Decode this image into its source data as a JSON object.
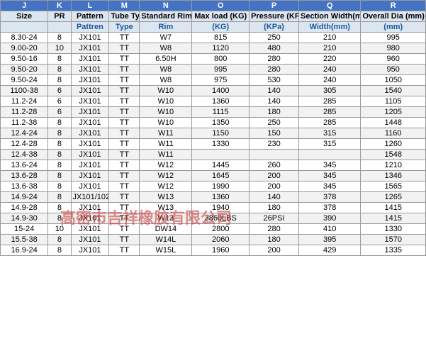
{
  "columns": {
    "headers_row1": [
      "J",
      "K",
      "L",
      "M",
      "N",
      "O",
      "P",
      "Q",
      "R"
    ],
    "headers_row2": [
      "Size",
      "PR",
      "Pattern",
      "Tube Type",
      "Standard Rim",
      "Max load (KG)",
      "Pressure (KPa)",
      "Section Width(mm)",
      "Overall Dia (mm)"
    ],
    "sub_headers": [
      "",
      "",
      "",
      "Type",
      "Rim",
      "(KG)",
      "(KPa)",
      "Width(mm)",
      "(mm)"
    ]
  },
  "rows": [
    [
      "8.30-24",
      "8",
      "JX101",
      "TT",
      "W7",
      "815",
      "250",
      "210",
      "995"
    ],
    [
      "9.00-20",
      "10",
      "JX101",
      "TT",
      "W8",
      "1120",
      "480",
      "210",
      "980"
    ],
    [
      "9.50-16",
      "8",
      "JX101",
      "TT",
      "6.50H",
      "800",
      "280",
      "220",
      "960"
    ],
    [
      "9.50-20",
      "8",
      "JX101",
      "TT",
      "W8",
      "995",
      "280",
      "240",
      "950"
    ],
    [
      "9.50-24",
      "8",
      "JX101",
      "TT",
      "W8",
      "975",
      "530",
      "240",
      "1050"
    ],
    [
      "1100-38",
      "6",
      "JX101",
      "TT",
      "W10",
      "1400",
      "140",
      "305",
      "1540"
    ],
    [
      "11.2-24",
      "6",
      "JX101",
      "TT",
      "W10",
      "1360",
      "140",
      "285",
      "1105"
    ],
    [
      "11.2-28",
      "6",
      "JX101",
      "TT",
      "W10",
      "1115",
      "180",
      "285",
      "1205"
    ],
    [
      "11.2-38",
      "8",
      "JX101",
      "TT",
      "W10",
      "1350",
      "250",
      "285",
      "1448"
    ],
    [
      "12.4-24",
      "8",
      "JX101",
      "TT",
      "W11",
      "1150",
      "150",
      "315",
      "1160"
    ],
    [
      "12.4-28",
      "8",
      "JX101",
      "TT",
      "W11",
      "1330",
      "230",
      "315",
      "1260"
    ],
    [
      "12.4-38",
      "8",
      "JX101",
      "TT",
      "W11",
      "",
      "",
      "",
      "1548"
    ],
    [
      "13.6-24",
      "8",
      "JX101",
      "TT",
      "W12",
      "1445",
      "260",
      "345",
      "1210"
    ],
    [
      "13.6-28",
      "8",
      "JX101",
      "TT",
      "W12",
      "1645",
      "200",
      "345",
      "1346"
    ],
    [
      "13.6-38",
      "8",
      "JX101",
      "TT",
      "W12",
      "1990",
      "200",
      "345",
      "1565"
    ],
    [
      "14.9-24",
      "8",
      "JX101/102",
      "TT",
      "W13",
      "1360",
      "140",
      "378",
      "1265"
    ],
    [
      "14.9-28",
      "8",
      "JX101",
      "TT",
      "W13",
      "1940",
      "180",
      "378",
      "1415"
    ],
    [
      "14.9-30",
      "8",
      "JX101",
      "TT",
      "W13",
      "3860LBS",
      "26PSI",
      "390",
      "1415"
    ],
    [
      "15-24",
      "10",
      "JX101",
      "TT",
      "DW14",
      "2800",
      "280",
      "410",
      "1330"
    ],
    [
      "15.5-38",
      "8",
      "JX101",
      "TT",
      "W14L",
      "2060",
      "180",
      "395",
      "1570"
    ],
    [
      "16.9-24",
      "8",
      "JX101",
      "TT",
      "W15L",
      "1960",
      "200",
      "429",
      "1335"
    ]
  ],
  "watermark": "高密市吉祥橡胶有限公司"
}
